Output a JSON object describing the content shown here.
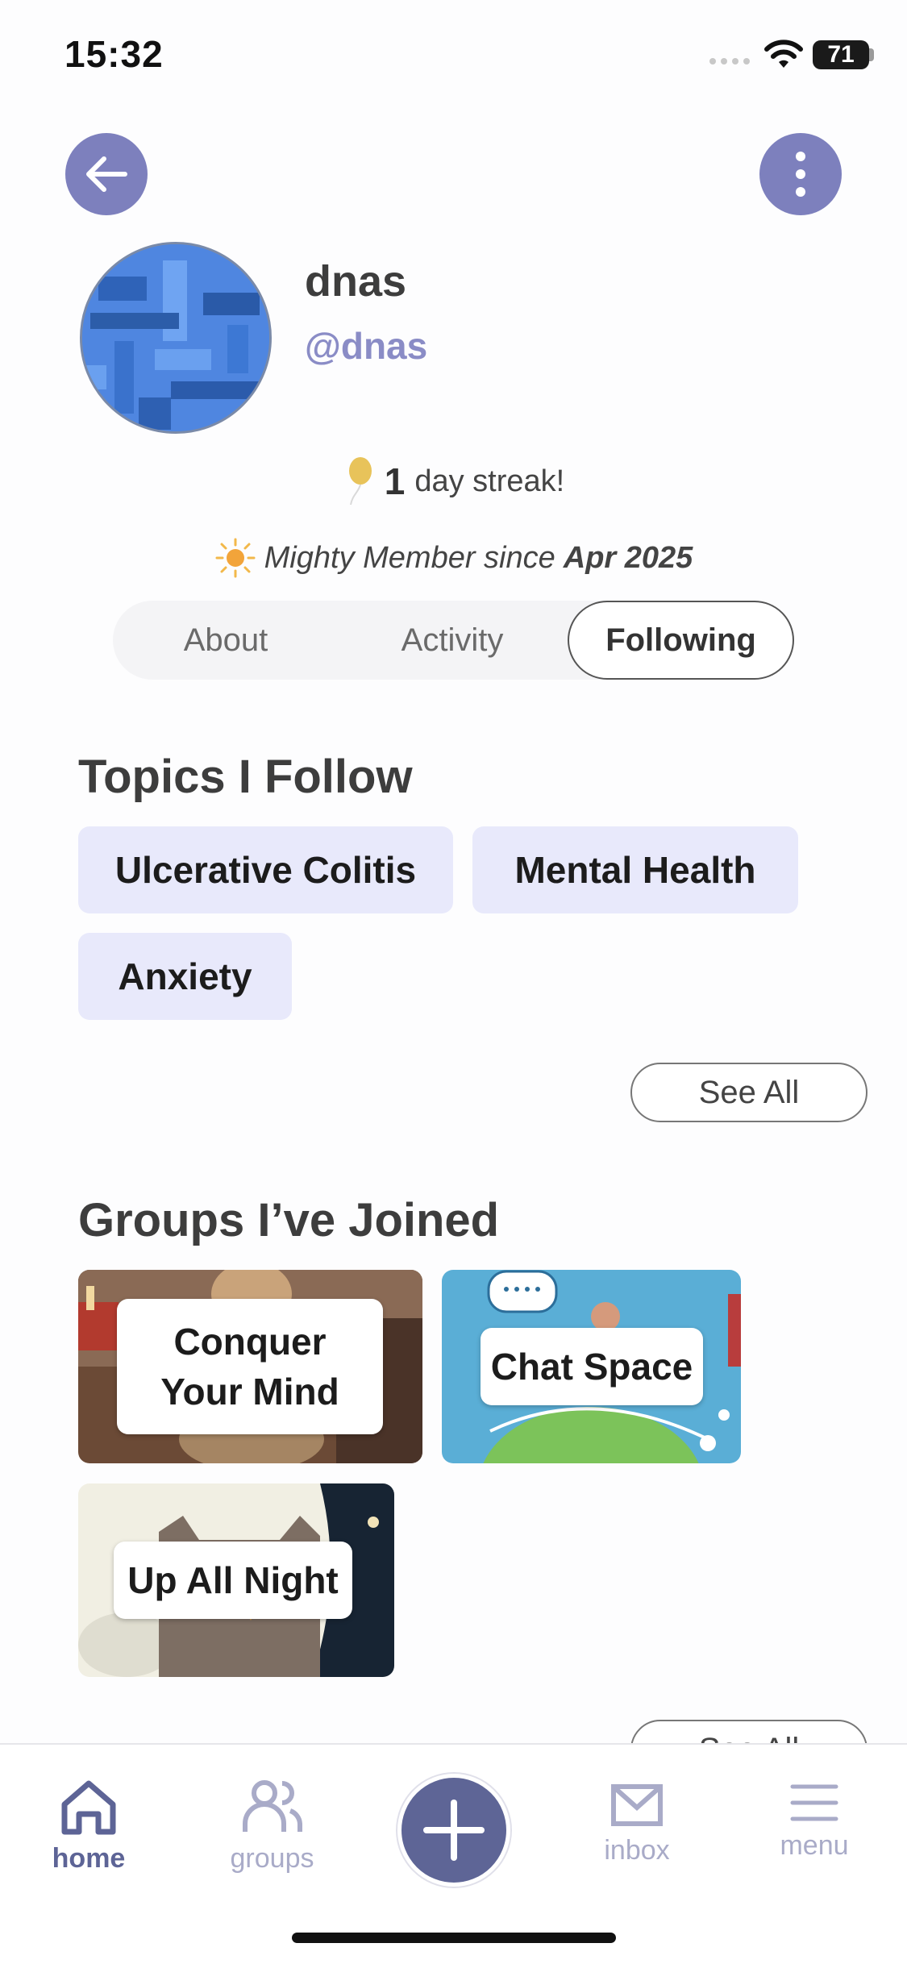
{
  "status_bar": {
    "time": "15:32",
    "battery": "71"
  },
  "profile": {
    "name": "dnas",
    "handle": "@dnas",
    "streak_count": "1",
    "streak_text": "day streak!",
    "member_prefix": "Mighty Member since",
    "member_since": "Apr 2025"
  },
  "tabs": [
    {
      "label": "About",
      "active": false
    },
    {
      "label": "Activity",
      "active": false
    },
    {
      "label": "Following",
      "active": true
    }
  ],
  "topics": {
    "title": "Topics I Follow",
    "items": [
      "Ulcerative Colitis",
      "Mental Health",
      "Anxiety"
    ],
    "see_all": "See All"
  },
  "groups": {
    "title": "Groups I’ve Joined",
    "items": [
      "Conquer\nYour Mind",
      "Chat Space",
      "Up All Night"
    ],
    "see_all": "See All"
  },
  "bottom_nav": {
    "home": "home",
    "groups": "groups",
    "inbox": "inbox",
    "menu": "menu"
  },
  "colors": {
    "accent": "#7d80bd",
    "nav_active": "#5d6496",
    "chip_bg": "#e8e9fb"
  },
  "icons": {
    "back": "arrow-left-icon",
    "more": "more-vertical-icon",
    "streak": "balloon-icon",
    "member": "sun-icon",
    "home": "home-icon",
    "groups": "users-icon",
    "add": "plus-icon",
    "inbox": "mail-icon",
    "menu": "hamburger-icon"
  }
}
